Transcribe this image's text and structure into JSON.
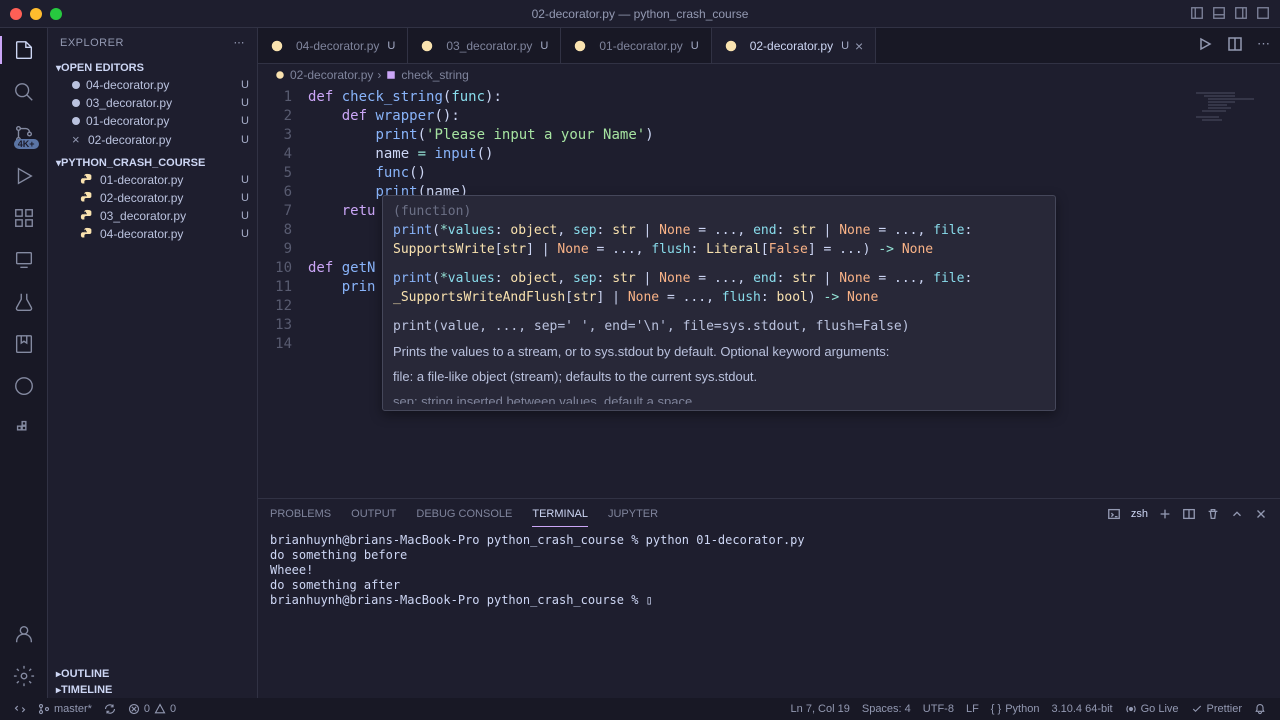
{
  "window": {
    "title": "02-decorator.py — python_crash_course"
  },
  "sidebar": {
    "title": "EXPLORER",
    "openEditors": {
      "label": "OPEN EDITORS",
      "items": [
        {
          "name": "04-decorator.py",
          "status": "U",
          "modified": true
        },
        {
          "name": "03_decorator.py",
          "status": "U",
          "modified": true
        },
        {
          "name": "01-decorator.py",
          "status": "U",
          "modified": true
        },
        {
          "name": "02-decorator.py",
          "status": "U",
          "modified": false,
          "closable": true
        }
      ]
    },
    "folder": {
      "label": "PYTHON_CRASH_COURSE",
      "items": [
        {
          "name": "01-decorator.py",
          "status": "U"
        },
        {
          "name": "02-decorator.py",
          "status": "U"
        },
        {
          "name": "03_decorator.py",
          "status": "U"
        },
        {
          "name": "04-decorator.py",
          "status": "U"
        }
      ]
    },
    "outline": "OUTLINE",
    "timeline": "TIMELINE"
  },
  "tabs": [
    {
      "name": "04-decorator.py",
      "status": "U",
      "active": false
    },
    {
      "name": "03_decorator.py",
      "status": "U",
      "active": false
    },
    {
      "name": "01-decorator.py",
      "status": "U",
      "active": false
    },
    {
      "name": "02-decorator.py",
      "status": "U",
      "active": true
    }
  ],
  "breadcrumb": {
    "file": "02-decorator.py",
    "symbol": "check_string"
  },
  "lineNumbers": [
    "1",
    "2",
    "3",
    "4",
    "5",
    "6",
    "7",
    "8",
    "9",
    "10",
    "11",
    "12",
    "13",
    "14"
  ],
  "hover": {
    "sig": "(function)",
    "l1a": "print(*values: object, sep: str | None = ..., end: str | None = ..., file:",
    "l1b": "SupportsWrite[str] | None = ..., flush: Literal[False] = ...) -> None",
    "l2a": "print(*values: object, sep: str | None = ..., end: str | None = ..., file:",
    "l2b": "_SupportsWriteAndFlush[str] | None = ..., flush: bool) -> None",
    "call": "print(value, ..., sep=' ', end='\\n', file=sys.stdout, flush=False)",
    "desc1": "Prints the values to a stream, or to sys.stdout by default. Optional keyword arguments:",
    "desc2": "file: a file-like object (stream); defaults to the current sys.stdout.",
    "desc3": "sep: string inserted between values, default a space"
  },
  "terminal": {
    "content": "brianhuynh@brians-MacBook-Pro python_crash_course % python 01-decorator.py\ndo something before\nWheee!\ndo something after\nbrianhuynh@brians-MacBook-Pro python_crash_course % ▯"
  },
  "panelTabs": {
    "problems": "PROBLEMS",
    "output": "OUTPUT",
    "debug": "DEBUG CONSOLE",
    "terminal": "TERMINAL",
    "jupyter": "JUPYTER",
    "shell": "zsh"
  },
  "statusbar": {
    "branch": "master*",
    "errors": "0",
    "warnings": "0",
    "cursor": "Ln 7, Col 19",
    "spaces": "Spaces: 4",
    "encoding": "UTF-8",
    "eol": "LF",
    "lang": "Python",
    "interpreter": "3.10.4 64-bit",
    "golive": "Go Live",
    "prettier": "Prettier"
  },
  "badge4k": "4K+"
}
